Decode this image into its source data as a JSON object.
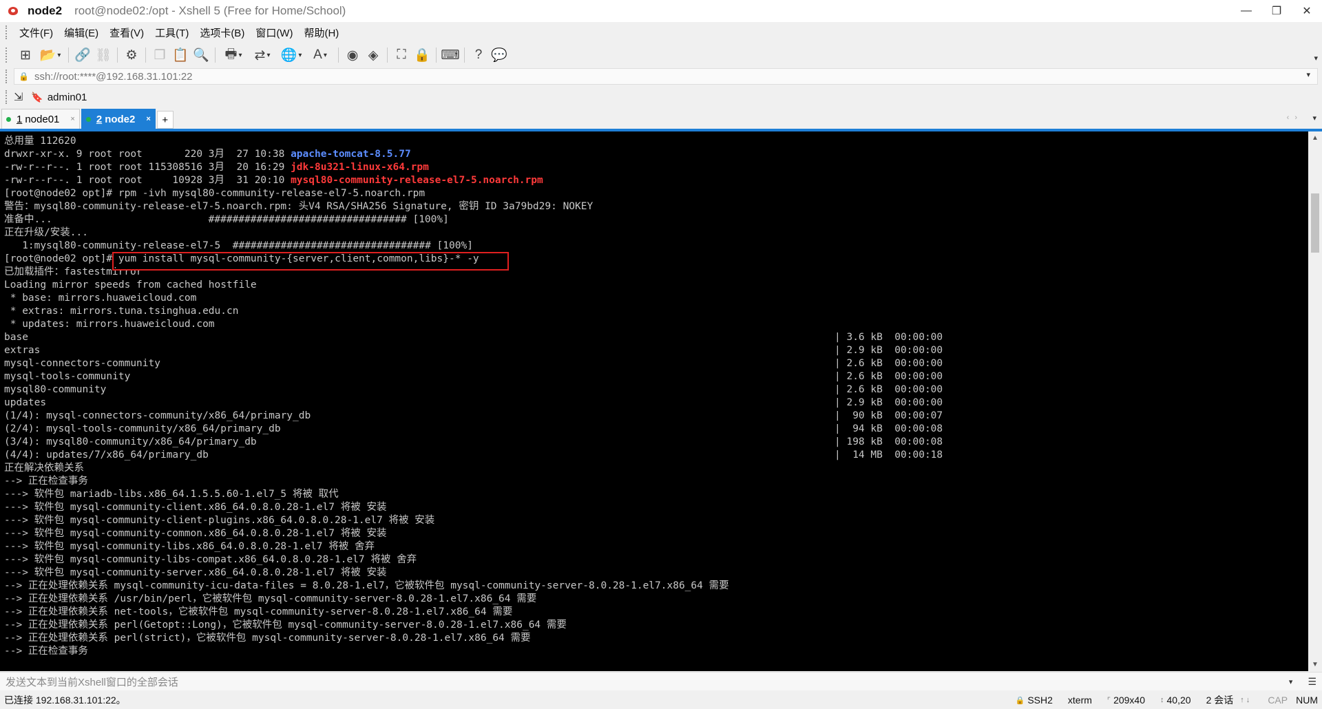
{
  "window": {
    "session_name": "node2",
    "title": "root@node02:/opt - Xshell 5 (Free for Home/School)",
    "minimize": "—",
    "maximize": "❐",
    "close": "✕"
  },
  "menu": [
    "文件(F)",
    "编辑(E)",
    "查看(V)",
    "工具(T)",
    "选项卡(B)",
    "窗口(W)",
    "帮助(H)"
  ],
  "address": {
    "value": "ssh://root:****@192.168.31.101:22",
    "lock_icon": "🔒"
  },
  "links": {
    "label": "admin01"
  },
  "tabs": [
    {
      "num": "1",
      "label": "node01",
      "close": "×",
      "status_color": "#22b14c"
    },
    {
      "num": "2",
      "label": "node2",
      "close": "×",
      "status_color": "#22b14c"
    }
  ],
  "tab_add": "+",
  "terminal": {
    "lines": [
      {
        "a": "总用量 112620"
      },
      {
        "a": "drwxr-xr-x. 9 root root       220 3月  27 10:38 ",
        "b": "apache-tomcat-8.5.77",
        "b_color": "dir"
      },
      {
        "a": "-rw-r--r--. 1 root root 115308516 3月  20 16:29 ",
        "b": "jdk-8u321-linux-x64.rpm",
        "b_color": "red"
      },
      {
        "a": "-rw-r--r--. 1 root root     10928 3月  31 20:10 ",
        "b": "mysql80-community-release-el7-5.noarch.rpm",
        "b_color": "red"
      },
      {
        "a": "[root@node02 opt]# rpm -ivh mysql80-community-release-el7-5.noarch.rpm"
      },
      {
        "a": "警告：mysql80-community-release-el7-5.noarch.rpm: 头V4 RSA/SHA256 Signature, 密钥 ID 3a79bd29: NOKEY"
      },
      {
        "a": "准备中...                          ################################# [100%]"
      },
      {
        "a": "正在升级/安装..."
      },
      {
        "a": "   1:mysql80-community-release-el7-5  ################################# [100%]"
      },
      {
        "a": "[root@node02 opt]# yum install mysql-community-{server,client,common,libs}-* -y"
      },
      {
        "a": "已加载插件：fastestmirror"
      },
      {
        "a": "Loading mirror speeds from cached hostfile"
      },
      {
        "a": " * base: mirrors.huaweicloud.com"
      },
      {
        "a": " * extras: mirrors.tuna.tsinghua.edu.cn"
      },
      {
        "a": " * updates: mirrors.huaweicloud.com"
      },
      {
        "a": "base",
        "c": "| 3.6 kB  00:00:00"
      },
      {
        "a": "extras",
        "c": "| 2.9 kB  00:00:00"
      },
      {
        "a": "mysql-connectors-community",
        "c": "| 2.6 kB  00:00:00"
      },
      {
        "a": "mysql-tools-community",
        "c": "| 2.6 kB  00:00:00"
      },
      {
        "a": "mysql80-community",
        "c": "| 2.6 kB  00:00:00"
      },
      {
        "a": "updates",
        "c": "| 2.9 kB  00:00:00"
      },
      {
        "a": "(1/4): mysql-connectors-community/x86_64/primary_db",
        "c": "|  90 kB  00:00:07"
      },
      {
        "a": "(2/4): mysql-tools-community/x86_64/primary_db",
        "c": "|  94 kB  00:00:08"
      },
      {
        "a": "(3/4): mysql80-community/x86_64/primary_db",
        "c": "| 198 kB  00:00:08"
      },
      {
        "a": "(4/4): updates/7/x86_64/primary_db",
        "c": "|  14 MB  00:00:18"
      },
      {
        "a": "正在解决依赖关系"
      },
      {
        "a": "--> 正在检查事务"
      },
      {
        "a": "---> 软件包 mariadb-libs.x86_64.1.5.5.60-1.el7_5 将被 取代"
      },
      {
        "a": "---> 软件包 mysql-community-client.x86_64.0.8.0.28-1.el7 将被 安装"
      },
      {
        "a": "---> 软件包 mysql-community-client-plugins.x86_64.0.8.0.28-1.el7 将被 安装"
      },
      {
        "a": "---> 软件包 mysql-community-common.x86_64.0.8.0.28-1.el7 将被 安装"
      },
      {
        "a": "---> 软件包 mysql-community-libs.x86_64.0.8.0.28-1.el7 将被 舍弃"
      },
      {
        "a": "---> 软件包 mysql-community-libs-compat.x86_64.0.8.0.28-1.el7 将被 舍弃"
      },
      {
        "a": "---> 软件包 mysql-community-server.x86_64.0.8.0.28-1.el7 将被 安装"
      },
      {
        "a": "--> 正在处理依赖关系 mysql-community-icu-data-files = 8.0.28-1.el7，它被软件包 mysql-community-server-8.0.28-1.el7.x86_64 需要"
      },
      {
        "a": "--> 正在处理依赖关系 /usr/bin/perl，它被软件包 mysql-community-server-8.0.28-1.el7.x86_64 需要"
      },
      {
        "a": "--> 正在处理依赖关系 net-tools，它被软件包 mysql-community-server-8.0.28-1.el7.x86_64 需要"
      },
      {
        "a": "--> 正在处理依赖关系 perl(Getopt::Long)，它被软件包 mysql-community-server-8.0.28-1.el7.x86_64 需要"
      },
      {
        "a": "--> 正在处理依赖关系 perl(strict)，它被软件包 mysql-community-server-8.0.28-1.el7.x86_64 需要"
      },
      {
        "a": "--> 正在检查事务"
      }
    ]
  },
  "sendbar": {
    "placeholder": "发送文本到当前Xshell窗口的全部会话"
  },
  "status": {
    "connection": "已连接 192.168.31.101:22。",
    "protocol": "SSH2",
    "terminal_type": "xterm",
    "size": "209x40",
    "cursor": "40,20",
    "sessions": "2 会话",
    "cap": "CAP",
    "num": "NUM"
  },
  "colors": {
    "accent": "#1e7fd6",
    "terminal_bg": "#000000",
    "terminal_fg": "#c8c8c8",
    "dir": "#5c8dff",
    "archive": "#ff3a3a",
    "highlight_box": "#e02020"
  }
}
